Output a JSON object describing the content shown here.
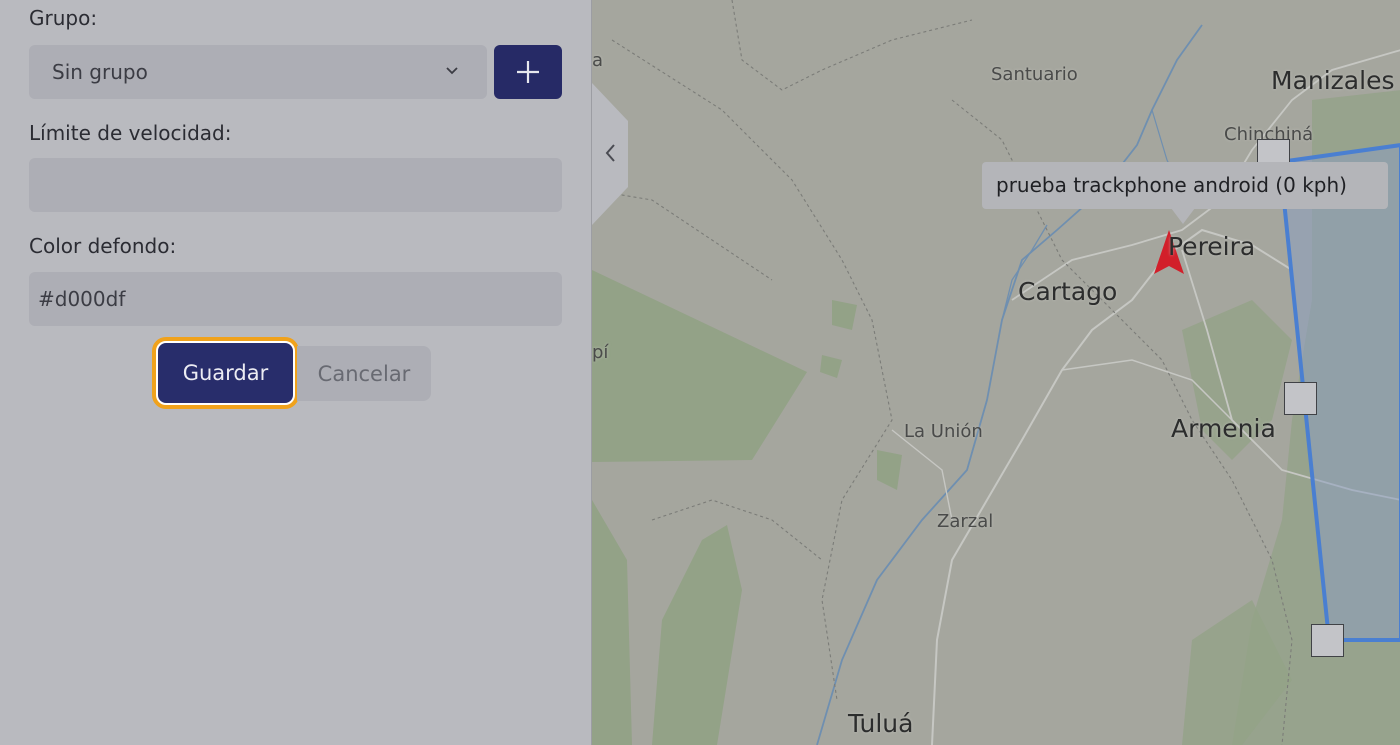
{
  "form": {
    "group_label": "Grupo:",
    "group_value": "Sin grupo",
    "speed_label": "Límite de velocidad:",
    "speed_value": "",
    "color_label": "Color defondo:",
    "color_value": "#d000df",
    "save_label": "Guardar",
    "cancel_label": "Cancelar"
  },
  "map": {
    "cities": {
      "santuario": "Santuario",
      "manizales": "Manizales",
      "chinchina": "Chinchiná",
      "pereira": "Pereira",
      "cartago": "Cartago",
      "armenia": "Armenia",
      "la_union": "La Unión",
      "zarzal": "Zarzal",
      "tulua": "Tuluá",
      "edge_top": "a",
      "edge_mid": "pí"
    },
    "tooltip": "prueba trackphone android (0 kph)",
    "marker_color": "#d21f2a",
    "polygon_color": "#4a7fd1"
  },
  "colors": {
    "primary": "#282d6b",
    "focus_ring": "#f0a21c"
  },
  "icons": {
    "add": "plus-icon",
    "select": "chevron-down-icon",
    "collapse": "chevron-left-icon",
    "marker": "navigation-arrow-icon"
  }
}
